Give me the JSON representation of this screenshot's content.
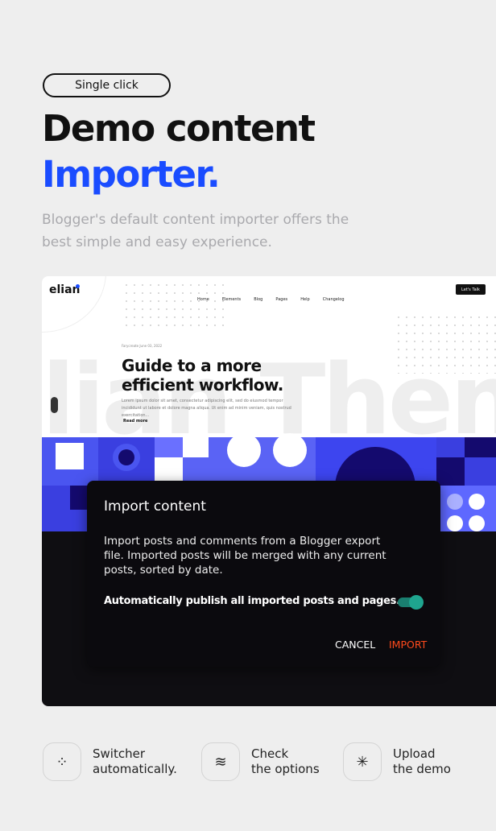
{
  "badge": "Single click",
  "heading": {
    "line1": "Demo content",
    "line2": "Importer."
  },
  "description": "Blogger's default content importer offers the best simple and easy experience.",
  "colors": {
    "accent": "#1a4cff",
    "import": "#ff4a1c",
    "toggle": "#1fa58f"
  },
  "preview": {
    "logo": "elian",
    "nav": [
      "Home",
      "Elements",
      "Blog",
      "Pages",
      "Help",
      "Changelog"
    ],
    "cta": "Let's Talk",
    "meta": "Farycreate   June 03, 2022",
    "title_line1": "Guide to a more",
    "title_line2": "efficient workflow.",
    "body": "Lorem ipsum dolor sit amet, consectetur adipiscing elit, sed do eiusmod tempor incididunt ut labore et dolore magna aliqua. Ut enim ad minim veniam, quis nostrud exercitation...",
    "read_more": "Read more",
    "bg_text": "lian Then"
  },
  "dialog": {
    "title": "Import content",
    "body": "Import posts and comments from a Blogger export file. Imported posts will be merged with any current posts, sorted by date.",
    "toggle_label": "Automatically publish all imported posts and pages.",
    "toggle_on": true,
    "cancel": "CANCEL",
    "import": "IMPORT"
  },
  "features": [
    {
      "icon": "loader-dots-icon",
      "line1": "Switcher",
      "line2": "automatically."
    },
    {
      "icon": "layers-icon",
      "line1": "Check",
      "line2": "the options"
    },
    {
      "icon": "spinner-icon",
      "line1": "Upload",
      "line2": "the demo"
    }
  ]
}
